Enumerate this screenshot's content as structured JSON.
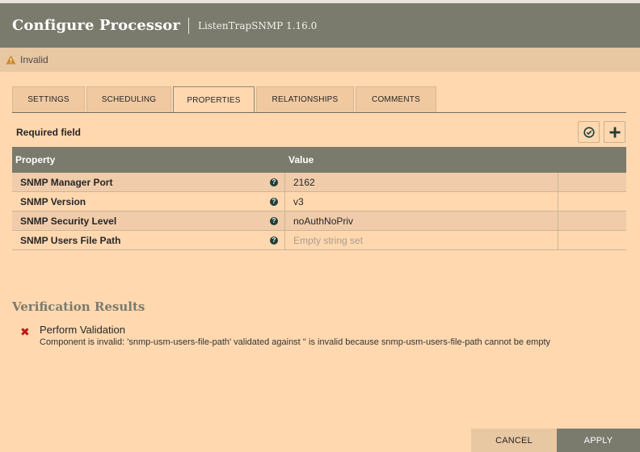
{
  "dialog": {
    "title": "Configure Processor",
    "subtitle": "ListenTrapSNMP 1.16.0",
    "status": "Invalid"
  },
  "tabs": [
    {
      "label": "SETTINGS"
    },
    {
      "label": "SCHEDULING"
    },
    {
      "label": "PROPERTIES",
      "active": true
    },
    {
      "label": "RELATIONSHIPS"
    },
    {
      "label": "COMMENTS"
    }
  ],
  "properties": {
    "required_label": "Required field",
    "columns": {
      "property": "Property",
      "value": "Value"
    },
    "rows": [
      {
        "name": "SNMP Manager Port",
        "value": "2162"
      },
      {
        "name": "SNMP Version",
        "value": "v3"
      },
      {
        "name": "SNMP Security Level",
        "value": "noAuthNoPriv"
      },
      {
        "name": "SNMP Users File Path",
        "value": "Empty string set"
      }
    ],
    "help_glyph": "?"
  },
  "verification": {
    "title": "Verification Results",
    "items": [
      {
        "title": "Perform Validation",
        "message": "Component is invalid: 'snmp-usm-users-file-path' validated against '' is invalid because snmp-usm-users-file-path cannot be empty"
      }
    ]
  },
  "buttons": {
    "cancel": "CANCEL",
    "apply": "APPLY"
  },
  "icons": {
    "warning": "warning-icon",
    "verify": "check-circle-icon",
    "add": "plus-icon",
    "error": "error-x-icon",
    "help": "help-icon"
  },
  "colors": {
    "header": "#7a7b6c",
    "background": "#ffd8b0",
    "error": "#ba1a1a",
    "warning": "#c98a2a"
  }
}
